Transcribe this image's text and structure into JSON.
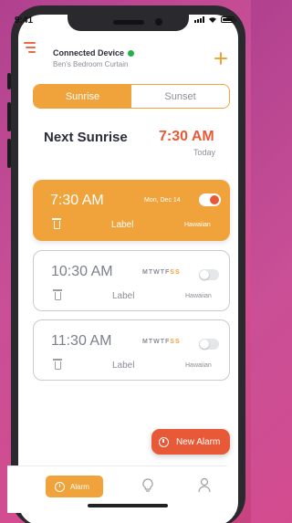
{
  "status_bar": {
    "time": "9:41"
  },
  "header": {
    "device_title": "Connected Device",
    "device_subtitle": "Ben's Bedroom Curtain",
    "status_color": "#22b04b"
  },
  "tabs": [
    {
      "label": "Sunrise",
      "selected": true
    },
    {
      "label": "Sunset",
      "selected": false
    }
  ],
  "next": {
    "title": "Next Sunrise",
    "time": "7:30 AM",
    "day": "Today"
  },
  "alarms": [
    {
      "time": "7:30 AM",
      "date": "Mon, Dec 14",
      "days": [],
      "label": "Label",
      "tone": "Hawaiian",
      "enabled": true
    },
    {
      "time": "10:30 AM",
      "date": "",
      "days": [
        "M",
        "T",
        "W",
        "T",
        "F",
        "S",
        "S"
      ],
      "label": "Label",
      "tone": "Hawaiian",
      "enabled": false
    },
    {
      "time": "11:30 AM",
      "date": "",
      "days": [
        "M",
        "T",
        "W",
        "T",
        "F",
        "S",
        "S"
      ],
      "label": "Label",
      "tone": "Hawaiian",
      "enabled": false
    }
  ],
  "fab": {
    "label": "New Alarm"
  },
  "nav": {
    "alarm_label": "Alarm",
    "icons": [
      "alarm-clock-icon",
      "bulb-icon",
      "user-icon"
    ]
  },
  "colors": {
    "accent": "#f0a33a",
    "primary_red": "#e85a37",
    "text_dark": "#2b2d3a"
  }
}
